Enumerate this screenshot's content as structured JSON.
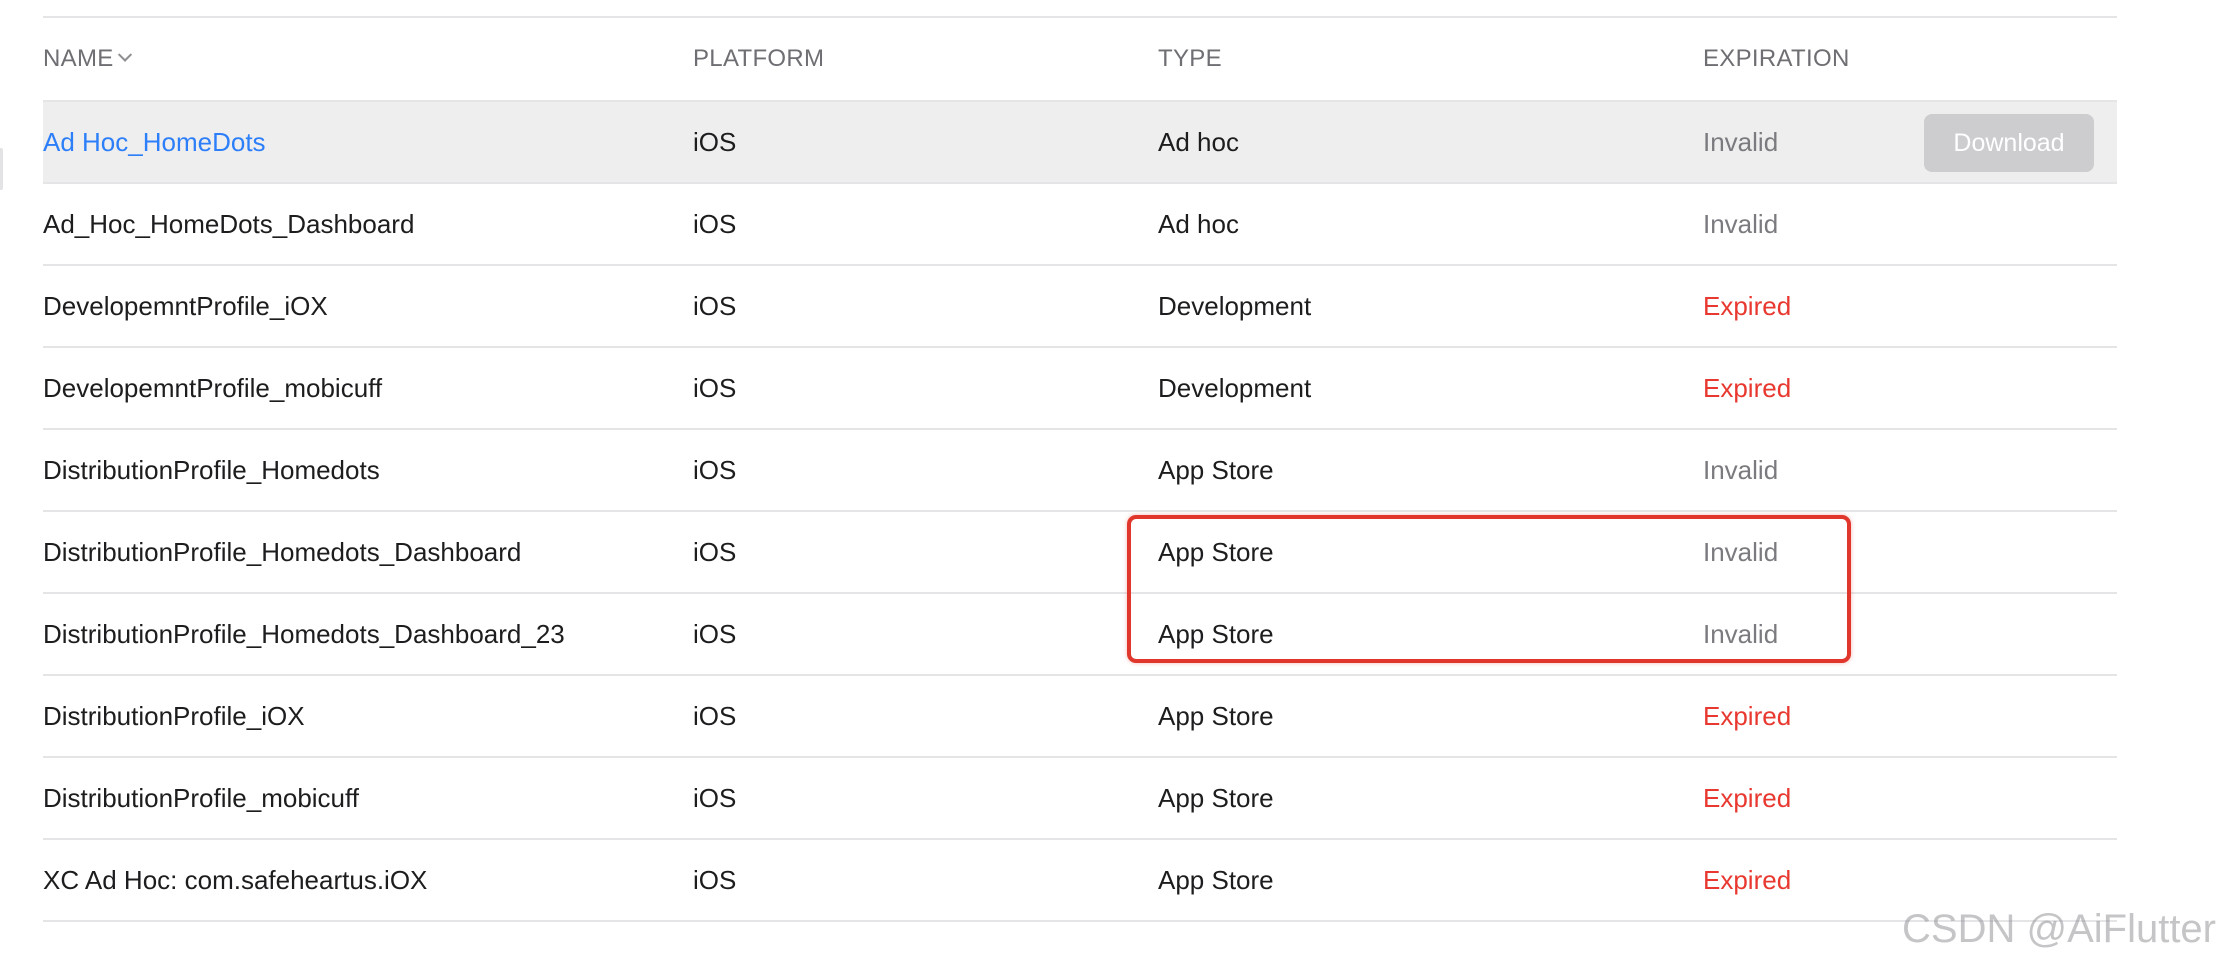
{
  "table": {
    "headers": {
      "name": "NAME",
      "platform": "PLATFORM",
      "type": "TYPE",
      "expiration": "EXPIRATION"
    },
    "download_label": "Download",
    "rows": [
      {
        "name": "Ad Hoc_HomeDots",
        "platform": "iOS",
        "type": "Ad hoc",
        "expiration": "Invalid"
      },
      {
        "name": "Ad_Hoc_HomeDots_Dashboard",
        "platform": "iOS",
        "type": "Ad hoc",
        "expiration": "Invalid"
      },
      {
        "name": "DevelopemntProfile_iOX",
        "platform": "iOS",
        "type": "Development",
        "expiration": "Expired"
      },
      {
        "name": "DevelopemntProfile_mobicuff",
        "platform": "iOS",
        "type": "Development",
        "expiration": "Expired"
      },
      {
        "name": "DistributionProfile_Homedots",
        "platform": "iOS",
        "type": "App Store",
        "expiration": "Invalid"
      },
      {
        "name": "DistributionProfile_Homedots_Dashboard",
        "platform": "iOS",
        "type": "App Store",
        "expiration": "Invalid"
      },
      {
        "name": "DistributionProfile_Homedots_Dashboard_23",
        "platform": "iOS",
        "type": "App Store",
        "expiration": "Invalid"
      },
      {
        "name": "DistributionProfile_iOX",
        "platform": "iOS",
        "type": "App Store",
        "expiration": "Expired"
      },
      {
        "name": "DistributionProfile_mobicuff",
        "platform": "iOS",
        "type": "App Store",
        "expiration": "Expired"
      },
      {
        "name": "XC Ad Hoc: com.safeheartus.iOX",
        "platform": "iOS",
        "type": "App Store",
        "expiration": "Expired"
      }
    ]
  },
  "watermark": "CSDN @AiFlutter",
  "colors": {
    "link": "#2d7ff9",
    "expired": "#e8382f",
    "invalid": "#7a7a7f",
    "highlight": "#e0362b",
    "selected_row": "#eeeeef"
  },
  "icons": {
    "sort": "chevron-down-icon"
  }
}
